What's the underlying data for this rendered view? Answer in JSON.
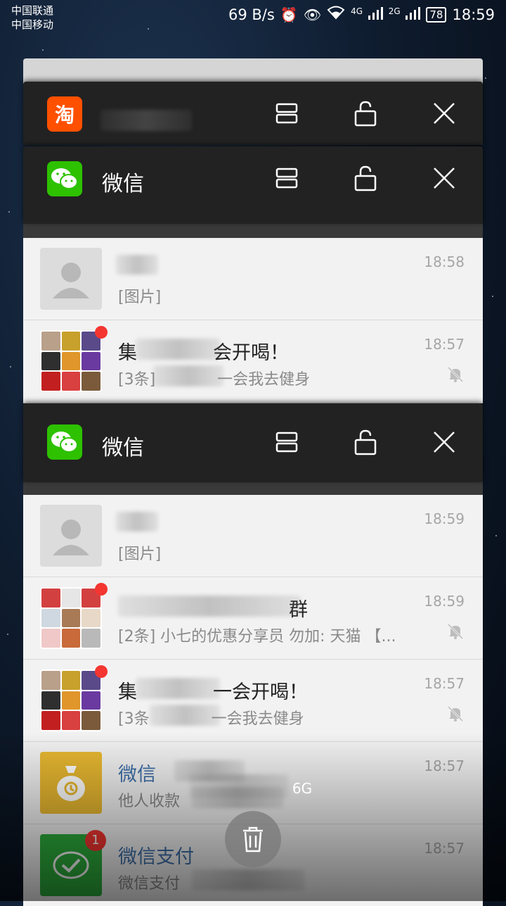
{
  "status_bar": {
    "carrier1": "中国联通",
    "carrier2": "中国移动",
    "net_speed": "69 B/s",
    "network_4g": "4G",
    "network_2g": "2G",
    "battery": "78",
    "time": "18:59"
  },
  "cards": {
    "taobao": {
      "app_name": ""
    },
    "wechat_mid": {
      "app_name": "微信",
      "rows": [
        {
          "title": "",
          "preview": "[图片]",
          "time": "18:58"
        },
        {
          "title": "集　　　　会开喝！",
          "preview": "[3条]　　　　一会我去健身",
          "time": "18:57"
        }
      ]
    },
    "wechat_front": {
      "app_name": "微信",
      "rows": [
        {
          "title": "",
          "preview": "[图片]",
          "time": "18:59"
        },
        {
          "title": "　　　　　　　　　群",
          "preview": "[2条] 小七的优惠分享员  勿加: 天猫 【...",
          "time": "18:59"
        },
        {
          "title": "集　　　　一会开喝！",
          "preview": "[3条　　　　一会我去健身",
          "time": "18:57"
        },
        {
          "title": "微信　　　　",
          "preview": "他人收款",
          "time": "18:57"
        },
        {
          "title": "微信支付",
          "preview": "微信支付",
          "time": "18:57",
          "badge": "1"
        }
      ]
    }
  },
  "memory": {
    "text": "6G"
  },
  "colors": {
    "wechat_green": "#2dc100",
    "taobao_orange": "#ff5000",
    "badge_red": "#f43530"
  }
}
